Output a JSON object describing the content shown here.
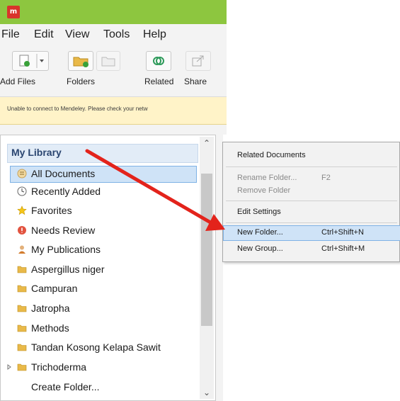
{
  "menubar": {
    "items": [
      "File",
      "Edit",
      "View",
      "Tools",
      "Help"
    ]
  },
  "toolbar": {
    "buttons": [
      "Add Files",
      "Folders",
      "Related",
      "Share"
    ]
  },
  "notice": {
    "text": "Unable to connect to Mendeley. Please check your netw"
  },
  "library": {
    "header": "My Library",
    "items": [
      {
        "label": "All Documents",
        "icon": "all-documents-icon",
        "selected": true
      },
      {
        "label": "Recently Added",
        "icon": "clock-icon"
      },
      {
        "label": "Favorites",
        "icon": "star-icon"
      },
      {
        "label": "Needs Review",
        "icon": "review-icon"
      },
      {
        "label": "My Publications",
        "icon": "person-icon"
      },
      {
        "label": "Aspergillus niger",
        "icon": "folder-icon"
      },
      {
        "label": "Campuran",
        "icon": "folder-icon"
      },
      {
        "label": "Jatropha",
        "icon": "folder-icon"
      },
      {
        "label": "Methods",
        "icon": "folder-icon"
      },
      {
        "label": "Tandan Kosong Kelapa Sawit",
        "icon": "folder-icon"
      },
      {
        "label": "Trichoderma",
        "icon": "folder-icon"
      },
      {
        "label": "Create Folder...",
        "icon": ""
      }
    ]
  },
  "context_menu": {
    "items": [
      {
        "label": "Related Documents",
        "shortcut": "",
        "disabled": false
      },
      {
        "label": "Rename Folder...",
        "shortcut": "F2",
        "disabled": true
      },
      {
        "label": "Remove Folder",
        "shortcut": "",
        "disabled": true
      },
      {
        "label": "Edit Settings",
        "shortcut": "",
        "disabled": false
      },
      {
        "label": "New Folder...",
        "shortcut": "Ctrl+Shift+N",
        "disabled": false,
        "highlighted": true
      },
      {
        "label": "New Group...",
        "shortcut": "Ctrl+Shift+M",
        "disabled": false
      }
    ]
  },
  "colors": {
    "titlebar": "#8dc63f",
    "selection": "#cfe3f7",
    "arrow": "#e3231b",
    "notice": "#fff3c8"
  }
}
